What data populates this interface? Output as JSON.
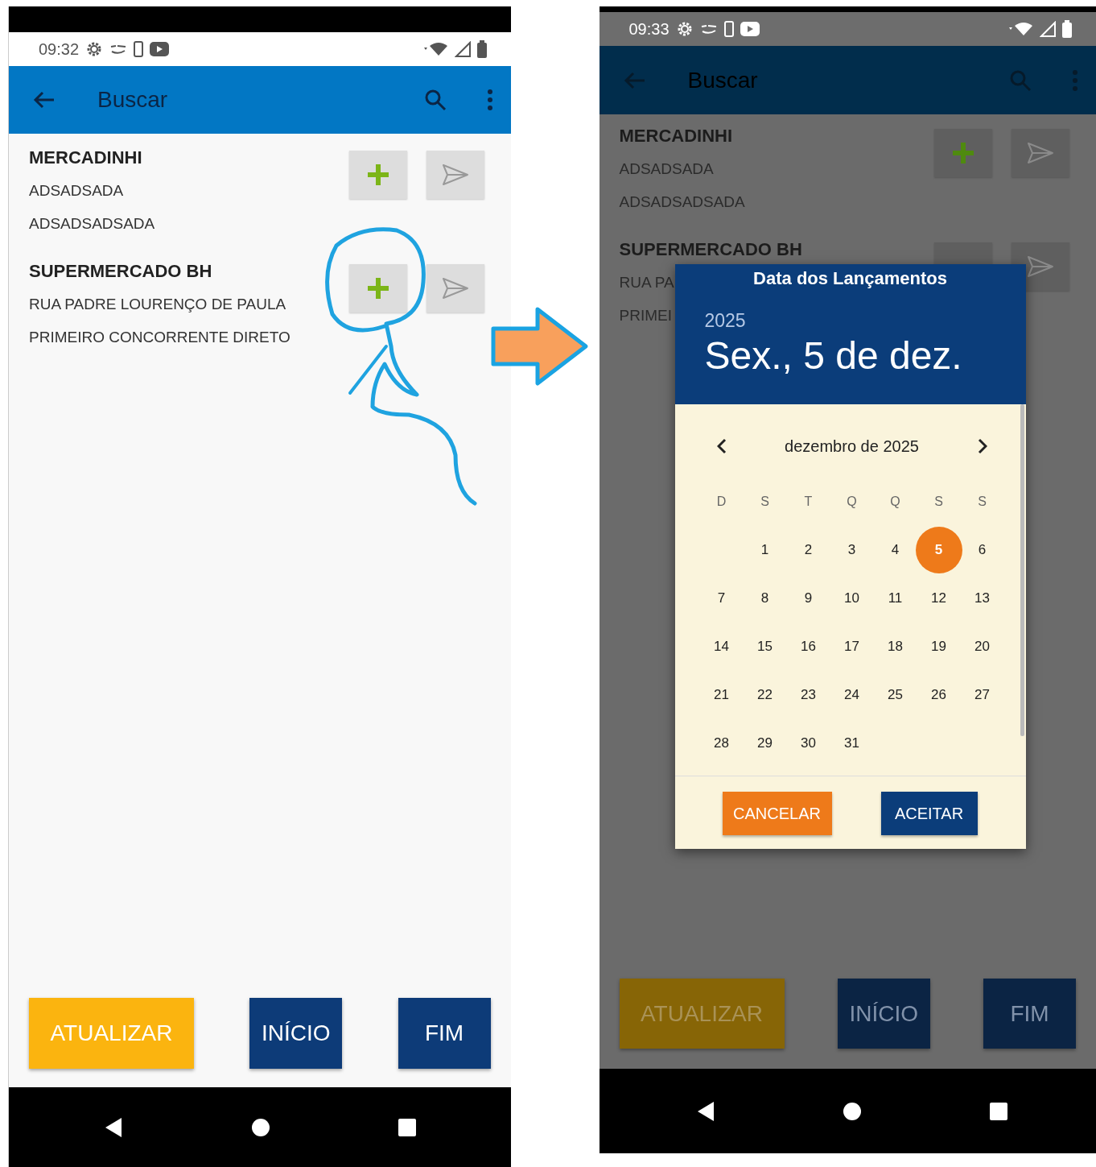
{
  "phones": [
    {
      "dimmed": false,
      "status_bar": {
        "time": "09:32"
      },
      "app_bar": {
        "title": "Buscar"
      },
      "stores": [
        {
          "name": "MERCADINHI",
          "lines": [
            "ADSADSADA",
            "ADSADSADSADA"
          ],
          "add_icon": true
        },
        {
          "name": "SUPERMERCADO BH",
          "lines": [
            "RUA PADRE LOURENÇO DE PAULA",
            "PRIMEIRO CONCORRENTE DIRETO"
          ],
          "add_icon": true
        }
      ],
      "buttons": [
        {
          "label": "ATUALIZAR",
          "kind": "refresh"
        },
        {
          "label": "INÍCIO",
          "kind": "start"
        },
        {
          "label": "FIM",
          "kind": "end"
        }
      ]
    },
    {
      "dimmed": true,
      "status_bar": {
        "time": "09:33"
      },
      "app_bar": {
        "title": "Buscar"
      },
      "stores": [
        {
          "name": "MERCADINHI",
          "lines": [
            "ADSADSADA",
            "ADSADSADSADA"
          ],
          "add_icon": true
        },
        {
          "name": "SUPERMERCADO BH",
          "lines": [
            "RUA PA",
            "PRIMEI"
          ],
          "add_icon": false
        }
      ],
      "buttons": [
        {
          "label": "ATUALIZAR",
          "kind": "refresh"
        },
        {
          "label": "INÍCIO",
          "kind": "start"
        },
        {
          "label": "FIM",
          "kind": "end"
        }
      ],
      "dialog": {
        "title": "Data dos Lançamentos",
        "year": "2025",
        "date": "Sex., 5 de dez.",
        "month": "dezembro de 2025",
        "weekdays": [
          "D",
          "S",
          "T",
          "Q",
          "Q",
          "S",
          "S"
        ],
        "weeks": [
          [
            {
              "label": "1",
              "selected": false
            },
            {
              "label": "2",
              "selected": false
            },
            {
              "label": "3",
              "selected": false
            },
            {
              "label": "4",
              "selected": false
            },
            {
              "label": "5",
              "selected": true
            },
            {
              "label": "6",
              "selected": false
            }
          ],
          [
            {
              "label": "7",
              "selected": false
            },
            {
              "label": "8",
              "selected": false
            },
            {
              "label": "9",
              "selected": false
            },
            {
              "label": "10",
              "selected": false
            },
            {
              "label": "11",
              "selected": false
            },
            {
              "label": "12",
              "selected": false
            },
            {
              "label": "13",
              "selected": false
            }
          ],
          [
            {
              "label": "14",
              "selected": false
            },
            {
              "label": "15",
              "selected": false
            },
            {
              "label": "16",
              "selected": false
            },
            {
              "label": "17",
              "selected": false
            },
            {
              "label": "18",
              "selected": false
            },
            {
              "label": "19",
              "selected": false
            },
            {
              "label": "20",
              "selected": false
            }
          ],
          [
            {
              "label": "21",
              "selected": false
            },
            {
              "label": "22",
              "selected": false
            },
            {
              "label": "23",
              "selected": false
            },
            {
              "label": "24",
              "selected": false
            },
            {
              "label": "25",
              "selected": false
            },
            {
              "label": "26",
              "selected": false
            },
            {
              "label": "27",
              "selected": false
            }
          ],
          [
            {
              "label": "28",
              "selected": false
            },
            {
              "label": "29",
              "selected": false
            },
            {
              "label": "30",
              "selected": false
            },
            {
              "label": "31",
              "selected": false
            }
          ]
        ],
        "buttons": [
          {
            "label": "CANCELAR",
            "kind": "cancel"
          },
          {
            "label": "ACEITAR",
            "kind": "accept"
          }
        ]
      }
    }
  ]
}
